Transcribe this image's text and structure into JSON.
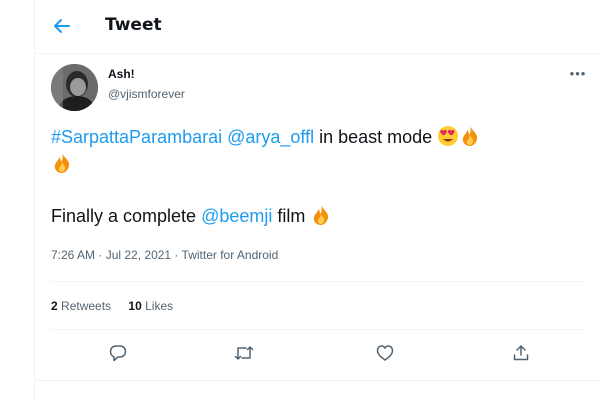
{
  "header": {
    "back_icon": "arrow-left-icon",
    "title": "Tweet"
  },
  "author": {
    "name": "Ash!",
    "handle": "@vjismforever",
    "avatar_icon": "profile-photo"
  },
  "tweet": {
    "line1": {
      "hashtag": "#SarpattaParambarai",
      "mention": "@arya_offl",
      "text": " in beast mode "
    },
    "line3": {
      "text_before": "Finally a complete ",
      "mention": "@beemji",
      "text_after": " film "
    },
    "emojis": [
      "heart-eyes-emoji",
      "fire-emoji",
      "fire-emoji",
      "fire-emoji"
    ]
  },
  "meta": {
    "time": "7:26 AM",
    "separator": " · ",
    "date": "Jul 22, 2021",
    "source": "Twitter for Android"
  },
  "stats": {
    "retweets_count": "2",
    "retweets_label": "Retweets",
    "likes_count": "10",
    "likes_label": "Likes"
  },
  "actions": [
    "reply-icon",
    "retweet-icon",
    "like-icon",
    "share-icon"
  ],
  "colors": {
    "accent": "#1d9bf0",
    "text": "#0f1419",
    "muted": "#536471",
    "border": "#eff3f4"
  }
}
